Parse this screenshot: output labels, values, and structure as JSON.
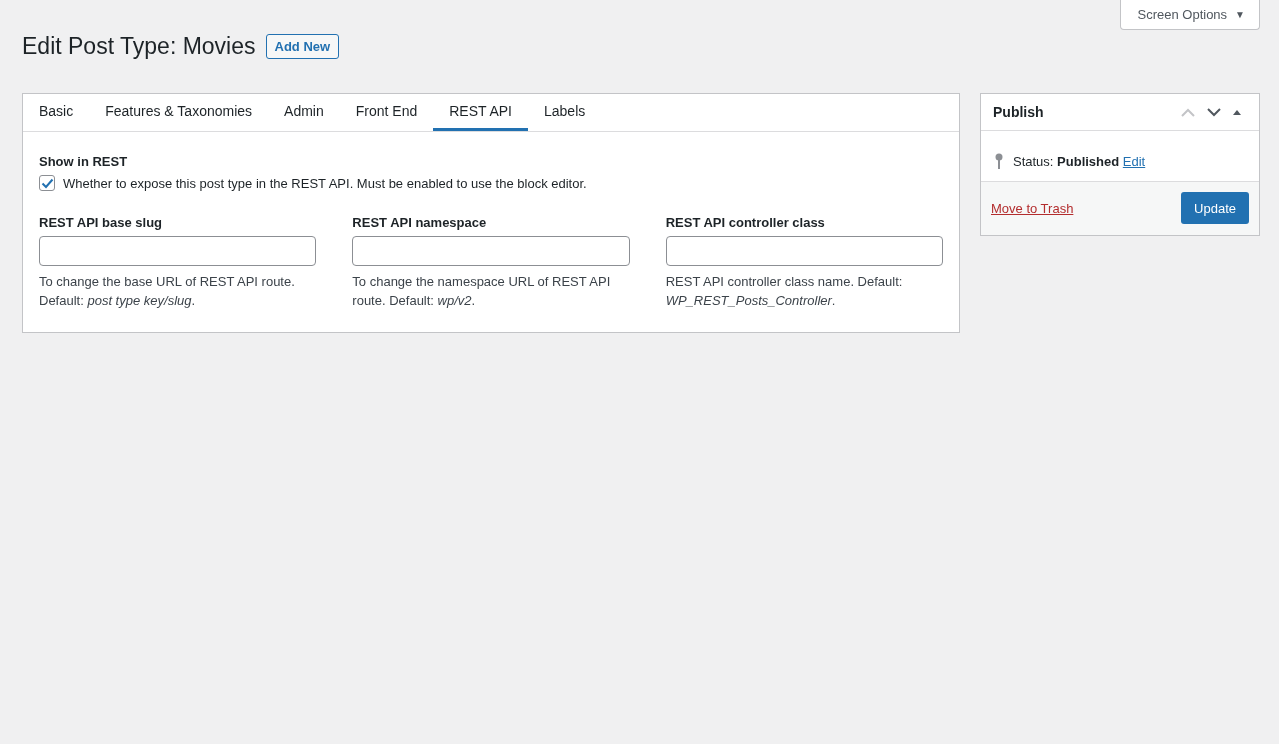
{
  "screen_options": {
    "label": "Screen Options",
    "caret": "▼"
  },
  "page": {
    "title": "Edit Post Type: Movies",
    "add_new": "Add New"
  },
  "tabs": [
    {
      "label": "Basic",
      "selected": false
    },
    {
      "label": "Features & Taxonomies",
      "selected": false
    },
    {
      "label": "Admin",
      "selected": false
    },
    {
      "label": "Front End",
      "selected": false
    },
    {
      "label": "REST API",
      "selected": true
    },
    {
      "label": "Labels",
      "selected": false
    }
  ],
  "show_in_rest": {
    "heading": "Show in REST",
    "checked": true,
    "label": "Whether to expose this post type in the REST API. Must be enabled to use the block editor."
  },
  "fields": [
    {
      "label": "REST API base slug",
      "help": "To change the base URL of REST API route. Default: *post type key/slug*."
    },
    {
      "label": "REST API namespace",
      "help": "To change the namespace URL of REST API route. Default: *wp/v2*."
    },
    {
      "label": "REST API controller class",
      "help": "REST API controller class name. Default: *WP_REST_Posts_Controller*."
    }
  ],
  "publish": {
    "title": "Publish",
    "move_up_disabled": true,
    "move_down_disabled": false,
    "status": "Status: **Published**",
    "status_link": "Edit",
    "trash": "Move to Trash",
    "update": "Update"
  }
}
